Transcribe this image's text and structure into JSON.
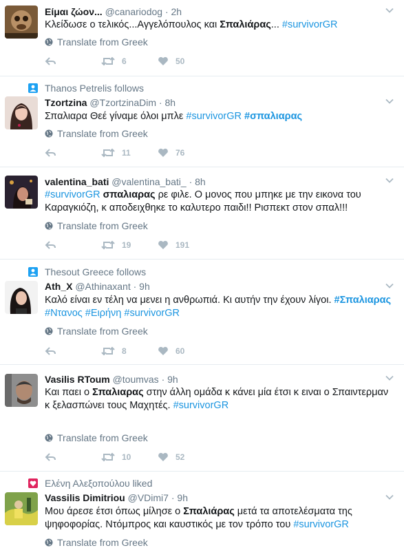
{
  "ui": {
    "translate_label": "Translate from Greek"
  },
  "tweets": [
    {
      "name": "Είμαι ζώον...",
      "handle": "@canariodog",
      "time": "2h",
      "text_parts": [
        {
          "t": "Κλείδωσε ο τελικός...Αγγελόπουλος και ",
          "s": ""
        },
        {
          "t": "Σπαλιάρας",
          "s": "b"
        },
        {
          "t": "... ",
          "s": ""
        },
        {
          "t": "#survivorGR",
          "s": "tag"
        }
      ],
      "retweets": "6",
      "likes": "50"
    },
    {
      "social": "Thanos Petrelis follows",
      "social_icon": "person-icon",
      "name": "Tzortzina",
      "handle": "@TzortzinaDim",
      "time": "8h",
      "text_parts": [
        {
          "t": "Σπαλιαρα Θεέ γίναμε όλοι μπλε ",
          "s": ""
        },
        {
          "t": "#survivorGR",
          "s": "tag"
        },
        {
          "t": " ",
          "s": ""
        },
        {
          "t": "#σπαλιαρας",
          "s": "tagb"
        }
      ],
      "retweets": "11",
      "likes": "76"
    },
    {
      "name": "valentina_bati",
      "handle": "@valentina_bati_",
      "time": "8h",
      "text_parts": [
        {
          "t": "#survivorGR",
          "s": "tag"
        },
        {
          "t": " ",
          "s": ""
        },
        {
          "t": "σπαλιαρας",
          "s": "b"
        },
        {
          "t": " ρε φιλε.   Ο μονος που μπηκε με την εικονα του Καραγκιόζη, κ αποδειχθηκε το καλυτερο παιδι!! Ρισπεκτ στον σπαλ!!!",
          "s": ""
        }
      ],
      "retweets": "19",
      "likes": "191"
    },
    {
      "social": "Thesout Greece follows",
      "social_icon": "person-icon",
      "name": "Ath_X",
      "handle": "@Athinaxant",
      "time": "9h",
      "text_parts": [
        {
          "t": "Καλό είναι εν τέλη να μενει η ανθρωπιά. Κι αυτήν την έχουν λίγοι. ",
          "s": ""
        },
        {
          "t": "#Σπαλιαρας",
          "s": "tagb"
        },
        {
          "t": " ",
          "s": ""
        },
        {
          "t": "#Ντανος",
          "s": "tag"
        },
        {
          "t": " ",
          "s": ""
        },
        {
          "t": "#Ειρήνη",
          "s": "tag"
        },
        {
          "t": " ",
          "s": ""
        },
        {
          "t": "#survivorGR",
          "s": "tag"
        }
      ],
      "retweets": "8",
      "likes": "60"
    },
    {
      "name": "Vasilis RToum",
      "handle": "@toumvas",
      "time": "9h",
      "text_parts": [
        {
          "t": "Και παει ο ",
          "s": ""
        },
        {
          "t": "Σπαλιαρας",
          "s": "b"
        },
        {
          "t": " στην άλλη ομάδα κ κάνει μία έτσι κ ειναι ο Σπαιντερμαν κ ξελασπώνει τους Μαχητές. ",
          "s": ""
        },
        {
          "t": "#survivorGR",
          "s": "tag"
        }
      ],
      "retweets": "10",
      "likes": "52"
    },
    {
      "social": "Ελένη Αλεξοπούλου liked",
      "social_icon": "heart-icon",
      "name": "Vassilis Dimitriou",
      "handle": "@VDimi7",
      "time": "9h",
      "text_parts": [
        {
          "t": "Μου άρεσε έτσι όπως μίλησε ο ",
          "s": ""
        },
        {
          "t": "Σπαλιάρας",
          "s": "b"
        },
        {
          "t": " μετά τα αποτελέσματα της ψηφοφορίας. Ντόμπρος και καυστικός με τον τρόπο του ",
          "s": ""
        },
        {
          "t": "#survivorGR",
          "s": "tag"
        }
      ],
      "retweets": "",
      "likes": ""
    }
  ],
  "colors": {
    "accent": "#1b95e0",
    "muted": "#657786",
    "icon": "#aab8c2",
    "liked_badge": "#e0245e",
    "follow_badge": "#1da1f2"
  }
}
